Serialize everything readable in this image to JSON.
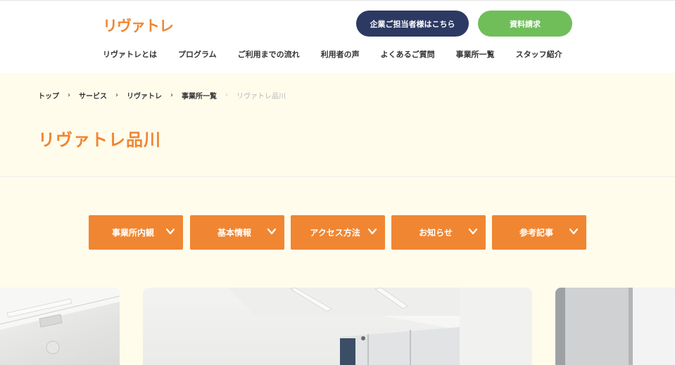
{
  "header": {
    "logo": "リヴァトレ",
    "corporate_button": "企業ご担当者様はこちら",
    "docs_button": "資料請求",
    "nav": [
      "リヴァトレとは",
      "プログラム",
      "ご利用までの流れ",
      "利用者の声",
      "よくあるご質問",
      "事業所一覧",
      "スタッフ紹介"
    ]
  },
  "breadcrumb": [
    "トップ",
    "サービス",
    "リヴァトレ",
    "事業所一覧",
    "リヴァトレ品川"
  ],
  "page_title": "リヴァトレ品川",
  "tabs": [
    "事業所内観",
    "基本情報",
    "アクセス方法",
    "お知らせ",
    "参考記事"
  ],
  "icons": {
    "tab_chevron": "chevron-down-icon",
    "breadcrumb_separator": "chevron-right-icon"
  },
  "colors": {
    "accent": "#f08632",
    "navy": "#2c3a63",
    "green": "#6fbe5a",
    "hero_background": "#fffcec"
  }
}
